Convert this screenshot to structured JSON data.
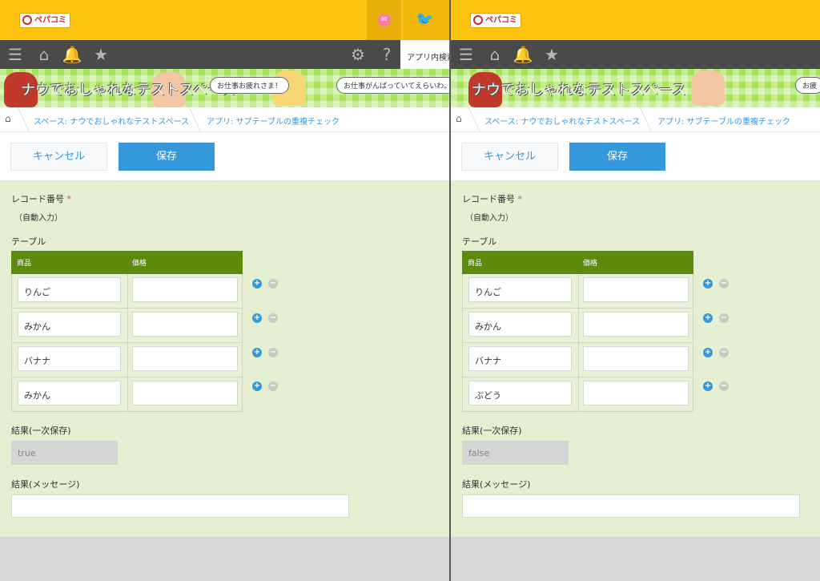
{
  "app": {
    "logo_text": "ペパコミ"
  },
  "nav": {
    "search_label": "アプリ内検索"
  },
  "banner": {
    "left_title": "ナウでおしゃれなテストスペース",
    "right_title": "ナウでおしゃれなテストスペース",
    "bubbles_left": [
      "お仕事お疲れさま！",
      "お仕事がんばっていてえらいわ。"
    ],
    "bubbles_right": [
      "お疲"
    ]
  },
  "breadcrumb": {
    "space": "スペース: ナウでおしゃれなテストスペース",
    "app": "アプリ: サブテーブルの重複チェック"
  },
  "actions": {
    "cancel": "キャンセル",
    "save": "保存"
  },
  "form": {
    "record_number_label": "レコード番号",
    "required_mark": "*",
    "record_number_value": "（自動入力）",
    "table_label": "テーブル",
    "table_headers": [
      "商品",
      "価格"
    ],
    "result_label": "結果(一次保存)",
    "message_label": "結果(メッセージ)"
  },
  "panels": [
    {
      "rows": [
        "りんご",
        "みかん",
        "バナナ",
        "みかん"
      ],
      "result_value": "true"
    },
    {
      "rows": [
        "りんご",
        "みかん",
        "バナナ",
        "ぶどう"
      ],
      "result_value": "false"
    }
  ],
  "colors": {
    "header_yellow": "#fdc510",
    "nav_dark": "#4a4a4a",
    "accent_blue": "#3498db",
    "table_header_green": "#5c8a0d",
    "form_bg": "#e5efd1"
  }
}
